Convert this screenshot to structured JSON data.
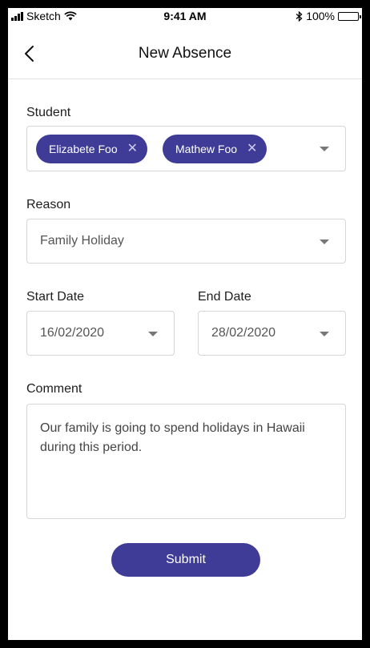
{
  "status_bar": {
    "carrier": "Sketch",
    "time": "9:41 AM",
    "battery": "100%",
    "signal_icon": "signal-bars-icon",
    "wifi_icon": "wifi-icon",
    "bluetooth_icon": "bluetooth-icon",
    "battery_icon": "battery-icon"
  },
  "nav": {
    "title": "New Absence",
    "back_icon": "chevron-left-icon"
  },
  "form": {
    "student": {
      "label": "Student",
      "chips": [
        {
          "name": "Elizabete Foo",
          "remove": "✕"
        },
        {
          "name": "Mathew Foo",
          "remove": "✕"
        }
      ]
    },
    "reason": {
      "label": "Reason",
      "value": "Family Holiday"
    },
    "start_date": {
      "label": "Start Date",
      "value": "16/02/2020"
    },
    "end_date": {
      "label": "End Date",
      "value": "28/02/2020"
    },
    "comment": {
      "label": "Comment",
      "value": "Our family is going to spend holidays in Hawaii during this period."
    },
    "submit_label": "Submit"
  },
  "colors": {
    "accent": "#3f3c97",
    "border": "#d6d6d6"
  }
}
